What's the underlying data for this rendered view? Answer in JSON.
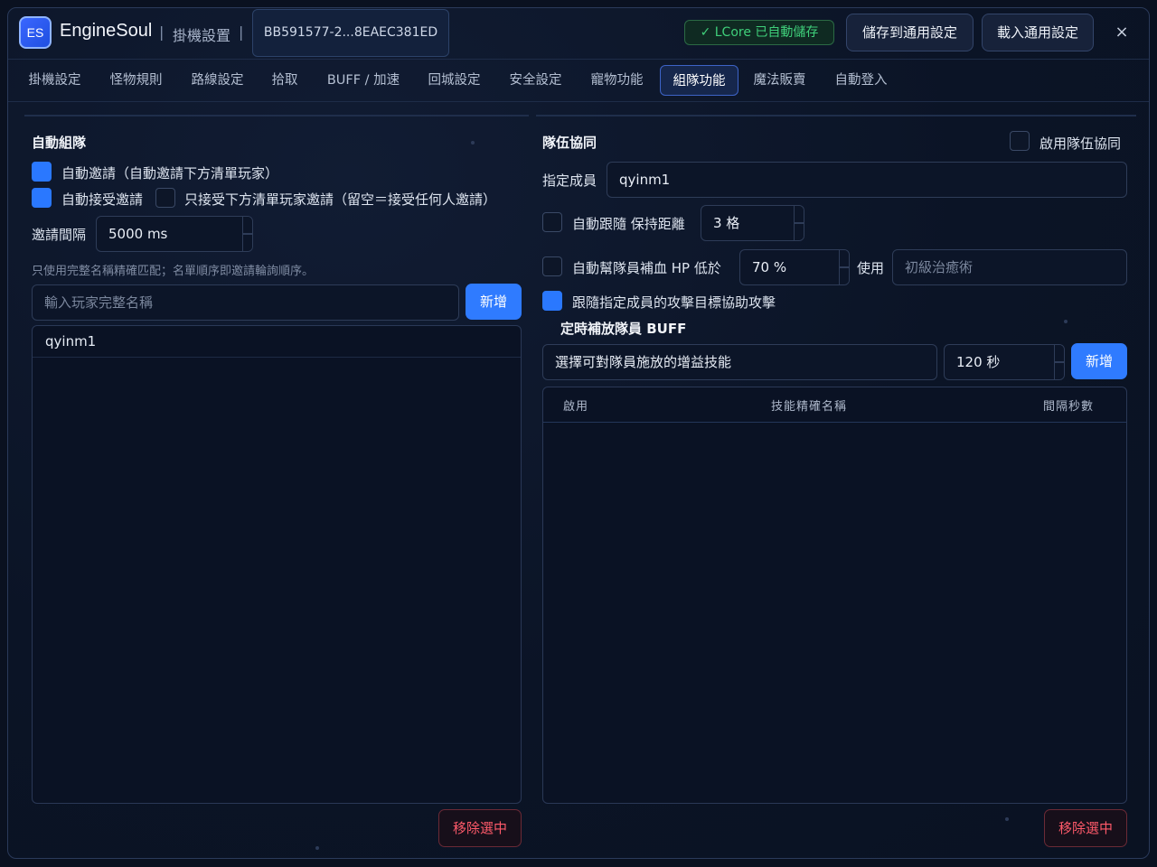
{
  "header": {
    "logo_text": "ES",
    "app_name": "EngineSoul",
    "separator": "|",
    "subtitle": "掛機設置",
    "device_id": "BB591577-2...8EAEC381ED",
    "autosave_status": "✓ LCore 已自動儲存",
    "save_common_label": "儲存到通用設定",
    "load_common_label": "載入通用設定",
    "close_symbol": "×"
  },
  "tabs": [
    {
      "label": "掛機設定",
      "active": false
    },
    {
      "label": "怪物規則",
      "active": false
    },
    {
      "label": "路線設定",
      "active": false
    },
    {
      "label": "拾取",
      "active": false
    },
    {
      "label": "BUFF / 加速",
      "active": false
    },
    {
      "label": "回城設定",
      "active": false
    },
    {
      "label": "安全設定",
      "active": false
    },
    {
      "label": "寵物功能",
      "active": false
    },
    {
      "label": "組隊功能",
      "active": true
    },
    {
      "label": "魔法販賣",
      "active": false
    },
    {
      "label": "自動登入",
      "active": false
    }
  ],
  "auto_party": {
    "title": "自動組隊",
    "auto_invite": {
      "label": "自動邀請（自動邀請下方清單玩家）",
      "checked": true
    },
    "auto_accept": {
      "label": "自動接受邀請",
      "checked": true
    },
    "accept_only_list": {
      "label": "只接受下方清單玩家邀請（留空＝接受任何人邀請）",
      "checked": false
    },
    "interval_label": "邀請間隔",
    "interval_value": "5000 ms",
    "hint": "只使用完整名稱精確匹配；名單順序即邀請輪詢順序。",
    "name_placeholder": "輸入玩家完整名稱",
    "add_label": "新增",
    "players": [
      "qyinm1"
    ],
    "remove_label": "移除選中"
  },
  "team_coop": {
    "title": "隊伍協同",
    "enable": {
      "label": "啟用隊伍協同",
      "checked": false
    },
    "member_label": "指定成員",
    "member_value": "qyinm1",
    "follow": {
      "label": "自動跟隨 保持距離",
      "checked": false,
      "value": "3 格"
    },
    "heal": {
      "label": "自動幫隊員補血 HP 低於",
      "checked": false,
      "value": "70 %",
      "use_label": "使用",
      "skill_placeholder": "初級治癒術"
    },
    "assist": {
      "label": "跟隨指定成員的攻擊目標協助攻擊",
      "checked": true
    },
    "buff_title": "定時補放隊員 BUFF",
    "buff_skill_placeholder": "選擇可對隊員施放的增益技能",
    "buff_interval": "120 秒",
    "add_label": "新增",
    "table_headers": {
      "enabled": "啟用",
      "skill_name": "技能精確名稱",
      "interval": "間隔秒數"
    },
    "rows": [],
    "remove_label": "移除選中"
  },
  "colors": {
    "accent": "#2f7bff",
    "danger": "#ff5a6a",
    "success": "#3fcf7a"
  }
}
